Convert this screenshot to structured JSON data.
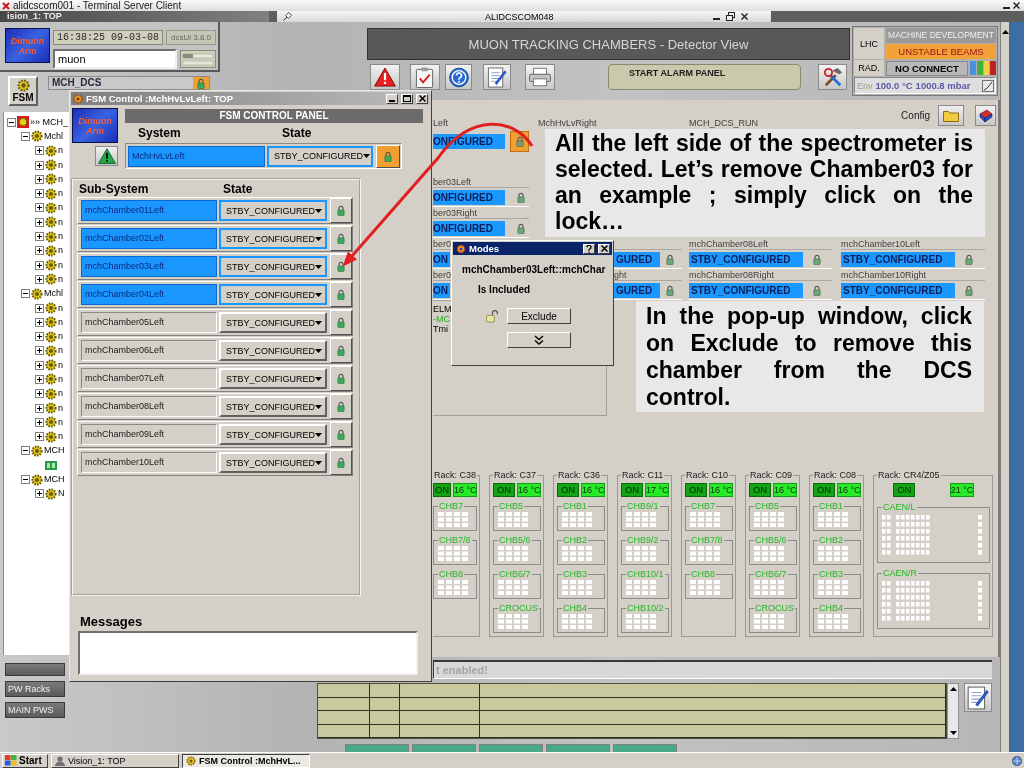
{
  "terminal": {
    "title": "alidcscom001 - Terminal Server Client"
  },
  "session_tab": "ision_1: TOP",
  "remote_window": {
    "title": "ALIDCSCOM048"
  },
  "dcs_header": {
    "logo": "Dimuon Arm",
    "clock": "16:38:25 09-03-08",
    "version": "dcsUi 3.8.0",
    "user": "muon",
    "fsm_button": "FSM",
    "top_node": "MCH_DCS"
  },
  "tree": [
    {
      "label": "»» MCH_",
      "kind": "root",
      "expanded": true,
      "children": [
        {
          "label": "Mchl",
          "kind": "node",
          "expanded": true,
          "children": [
            {
              "label": "n",
              "kind": "node",
              "expanded": false
            },
            {
              "label": "n",
              "kind": "node",
              "expanded": false
            },
            {
              "label": "n",
              "kind": "node",
              "expanded": false
            },
            {
              "label": "n",
              "kind": "node",
              "expanded": false
            },
            {
              "label": "n",
              "kind": "node",
              "expanded": false
            },
            {
              "label": "n",
              "kind": "node",
              "expanded": false
            },
            {
              "label": "n",
              "kind": "node",
              "expanded": false
            },
            {
              "label": "n",
              "kind": "node",
              "expanded": false
            },
            {
              "label": "n",
              "kind": "node",
              "expanded": false
            },
            {
              "label": "n",
              "kind": "node",
              "expanded": false
            }
          ]
        },
        {
          "label": "Mchl",
          "kind": "node",
          "expanded": true,
          "children": [
            {
              "label": "n",
              "kind": "node",
              "expanded": false
            },
            {
              "label": "n",
              "kind": "node",
              "expanded": false
            },
            {
              "label": "n",
              "kind": "node",
              "expanded": false
            },
            {
              "label": "n",
              "kind": "node",
              "expanded": false
            },
            {
              "label": "n",
              "kind": "node",
              "expanded": false
            },
            {
              "label": "n",
              "kind": "node",
              "expanded": false
            },
            {
              "label": "n",
              "kind": "node",
              "expanded": false
            },
            {
              "label": "n",
              "kind": "node",
              "expanded": false
            },
            {
              "label": "n",
              "kind": "node",
              "expanded": false
            },
            {
              "label": "n",
              "kind": "node",
              "expanded": false
            }
          ]
        },
        {
          "label": "MCH",
          "kind": "node",
          "expanded": true,
          "children": [
            {
              "kind": "device"
            }
          ]
        },
        {
          "label": "MCH",
          "kind": "node",
          "expanded": true,
          "children": [
            {
              "label": "N",
              "kind": "node",
              "expanded": false
            }
          ]
        }
      ]
    }
  ],
  "left_buttons": [
    {
      "label": "PW Racks"
    },
    {
      "label": "MAIN PWS"
    }
  ],
  "detector_view": {
    "title": "MUON TRACKING CHAMBERS - Detector View",
    "alarm_panel": "START ALARM PANEL",
    "config_label": "Config",
    "lhc": {
      "label": "LHC",
      "mode": "MACHINE DEVELOPMENT",
      "beam_state": "UNSTABLE BEAMS",
      "rad_label": "RAD.",
      "rad_state": "NO CONNECT",
      "env_label": "Env",
      "temperature": "100.0 °C",
      "pressure": "1000.8 mbar"
    },
    "columns": [
      {
        "header": {
          "label": "Left",
          "state": "ONFIGURED",
          "lock_highlight": true
        },
        "rows": [
          {
            "kind": "full",
            "label": "ber03Left",
            "state": "ONFIGURED"
          },
          {
            "kind": "full",
            "label": "ber03Right",
            "state": "ONFIGURED"
          },
          {
            "kind": "head",
            "label": "ber0",
            "state": "ON"
          },
          {
            "kind": "head",
            "label": "ber0",
            "state": "ON"
          }
        ]
      },
      {
        "header": {
          "label": "MchHvLvRight"
        },
        "rows": [
          {
            "kind": "tail",
            "state": "GURED"
          },
          {
            "kind": "tail",
            "label": "ght",
            "state": "GURED"
          }
        ]
      },
      {
        "header": {
          "label": "MCH_DCS_RUN"
        },
        "rows": [
          {
            "kind": "full",
            "label": "mchChamber08Left",
            "state": "STBY_CONFIGURED"
          },
          {
            "kind": "full",
            "label": "mchChamber08Right",
            "state": "STBY_CONFIGURED"
          }
        ]
      },
      {
        "rows": [
          {
            "kind": "full",
            "label": "mchChamber10Left",
            "state": "STBY_CONFIGURED"
          },
          {
            "kind": "full",
            "label": "mchChamber10Right",
            "state": "STBY_CONFIGURED"
          }
        ]
      }
    ],
    "side_panel": [
      {
        "text": "ELM",
        "kind": "plain"
      },
      {
        "text": "-MC",
        "kind": "ok"
      },
      {
        "text": "Tmi",
        "kind": "plain"
      }
    ],
    "racks": [
      {
        "kind": "edge",
        "title": "Rack: C38",
        "power": "ON",
        "temperature": "16 °C",
        "modules": [
          {
            "label": "CHB7"
          },
          {
            "label": "CHB7/8"
          },
          {
            "label": "CHB8"
          }
        ]
      },
      {
        "kind": "rack",
        "title": "Rack: C37",
        "power": "ON",
        "temperature": "16 °C",
        "modules": [
          {
            "label": "CHB5"
          },
          {
            "label": "CHB5/6"
          },
          {
            "label": "CHB6/7"
          },
          {
            "label": "CROCUS"
          }
        ]
      },
      {
        "kind": "rack",
        "title": "Rack: C36",
        "power": "ON",
        "temperature": "16 °C",
        "modules": [
          {
            "label": "CHB1"
          },
          {
            "label": "CHB2"
          },
          {
            "label": "CHB3"
          },
          {
            "label": "CHB4"
          }
        ]
      },
      {
        "kind": "rack",
        "title": "Rack: C11",
        "power": "ON",
        "temperature": "17 °C",
        "modules": [
          {
            "label": "CHB9/1"
          },
          {
            "label": "CHB9/2"
          },
          {
            "label": "CHB10/1"
          },
          {
            "label": "CHB10/2"
          }
        ]
      },
      {
        "kind": "rack",
        "title": "Rack: C10",
        "power": "ON",
        "temperature": "16 °C",
        "modules": [
          {
            "label": "CHB7"
          },
          {
            "label": "CHB7/8"
          },
          {
            "label": "CHB8"
          }
        ]
      },
      {
        "kind": "rack",
        "title": "Rack: C09",
        "power": "ON",
        "temperature": "16 °C",
        "modules": [
          {
            "label": "CHB5"
          },
          {
            "label": "CHB5/6"
          },
          {
            "label": "CHB6/7"
          },
          {
            "label": "CROCUS"
          }
        ]
      },
      {
        "kind": "rack",
        "title": "Rack: C08",
        "power": "ON",
        "temperature": "16 °C",
        "modules": [
          {
            "label": "CHB1"
          },
          {
            "label": "CHB2"
          },
          {
            "label": "CHB3"
          },
          {
            "label": "CHB4"
          }
        ]
      },
      {
        "kind": "crate",
        "title": "Rack: CR4/Z05",
        "power": "ON",
        "temperature": "21 °C",
        "modules": [
          {
            "label": "CAEN/L"
          },
          {
            "label": "CAEN/R"
          }
        ]
      }
    ],
    "status_message": "t enabled!"
  },
  "fsm_window": {
    "title": "FSM Control :MchHvLvLeft: TOP",
    "logo": "Dimuon Arm",
    "header": "FSM CONTROL PANEL",
    "system_heading": "System",
    "state_heading": "State",
    "system": {
      "name": "MchHvLvLeft",
      "state": "STBY_CONFIGURED",
      "selected": true,
      "lock_highlight": true
    },
    "subsystem_heading": "Sub-System",
    "subsystem_state_heading": "State",
    "subsystems": [
      {
        "name": "mchChamber01Left",
        "state": "STBY_CONFIGURED",
        "selected": true
      },
      {
        "name": "mchChamber02Left",
        "state": "STBY_CONFIGURED",
        "selected": true
      },
      {
        "name": "mchChamber03Left",
        "state": "STBY_CONFIGURED",
        "selected": true
      },
      {
        "name": "mchChamber04Left",
        "state": "STBY_CONFIGURED",
        "selected": true
      },
      {
        "name": "mchChamber05Left",
        "state": "STBY_CONFIGURED",
        "selected": false
      },
      {
        "name": "mchChamber06Left",
        "state": "STBY_CONFIGURED",
        "selected": false
      },
      {
        "name": "mchChamber07Left",
        "state": "STBY_CONFIGURED",
        "selected": false
      },
      {
        "name": "mchChamber08Left",
        "state": "STBY_CONFIGURED",
        "selected": false
      },
      {
        "name": "mchChamber09Left",
        "state": "STBY_CONFIGURED",
        "selected": false
      },
      {
        "name": "mchChamber10Left",
        "state": "STBY_CONFIGURED",
        "selected": false
      }
    ],
    "messages_label": "Messages"
  },
  "modes_popup": {
    "title": "Modes",
    "object": "mchChamber03Left::mchChar",
    "status": "Is Included",
    "action": "Exclude"
  },
  "annotations": [
    {
      "text": "All the left side of the spectrometer is selected. Let’s remove Chamber03 for an example ; simply click on the lock…"
    },
    {
      "text": "In the pop-up window, click on Exclude to remove this chamber from the DCS control."
    }
  ],
  "taskbar": {
    "start": "Start",
    "tasks": [
      {
        "label": "Vision_1: TOP",
        "selected": false
      },
      {
        "label": "FSM Control :MchHvL...",
        "selected": true
      }
    ]
  }
}
